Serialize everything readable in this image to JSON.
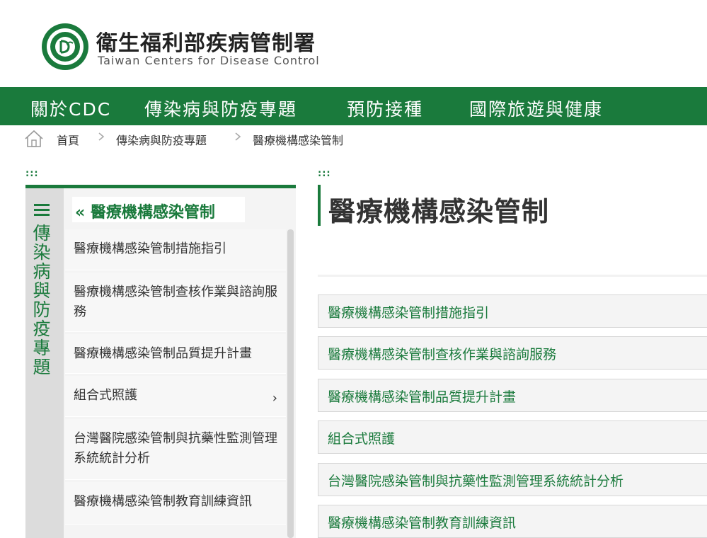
{
  "header": {
    "title_zh": "衛生福利部疾病管制署",
    "title_en": "Taiwan Centers for Disease Control",
    "logo_icon": "cdc-logo-icon"
  },
  "nav": {
    "items": [
      "關於CDC",
      "傳染病與防疫專題",
      "預防接種",
      "國際旅遊與健康"
    ]
  },
  "breadcrumb": {
    "home_icon": "home-icon",
    "items": [
      "首頁",
      "傳染病與防疫專題",
      "醫療機構感染管制"
    ]
  },
  "markers": {
    "dots": ":::"
  },
  "sidebar": {
    "tab_title": "傳染病與防疫專題",
    "menu_icon": "hamburger-icon",
    "heading": "« 醫療機構感染管制",
    "items": [
      {
        "label": "醫療機構感染管制措施指引"
      },
      {
        "label": "醫療機構感染管制查核作業與諮詢服務"
      },
      {
        "label": "醫療機構感染管制品質提升計畫"
      },
      {
        "label": "組合式照護",
        "arrow": "›"
      },
      {
        "label": "台灣醫院感染管制與抗藥性監測管理系統統計分析"
      },
      {
        "label": "醫療機構感染管制教育訓練資訊"
      }
    ]
  },
  "content": {
    "title": "醫療機構感染管制",
    "links": [
      "醫療機構感染管制措施指引",
      "醫療機構感染管制查核作業與諮詢服務",
      "醫療機構感染管制品質提升計畫",
      "組合式照護",
      "台灣醫院感染管制與抗藥性監測管理系統統計分析",
      "醫療機構感染管制教育訓練資訊"
    ]
  },
  "colors": {
    "brand_green": "#1a7a3c"
  }
}
